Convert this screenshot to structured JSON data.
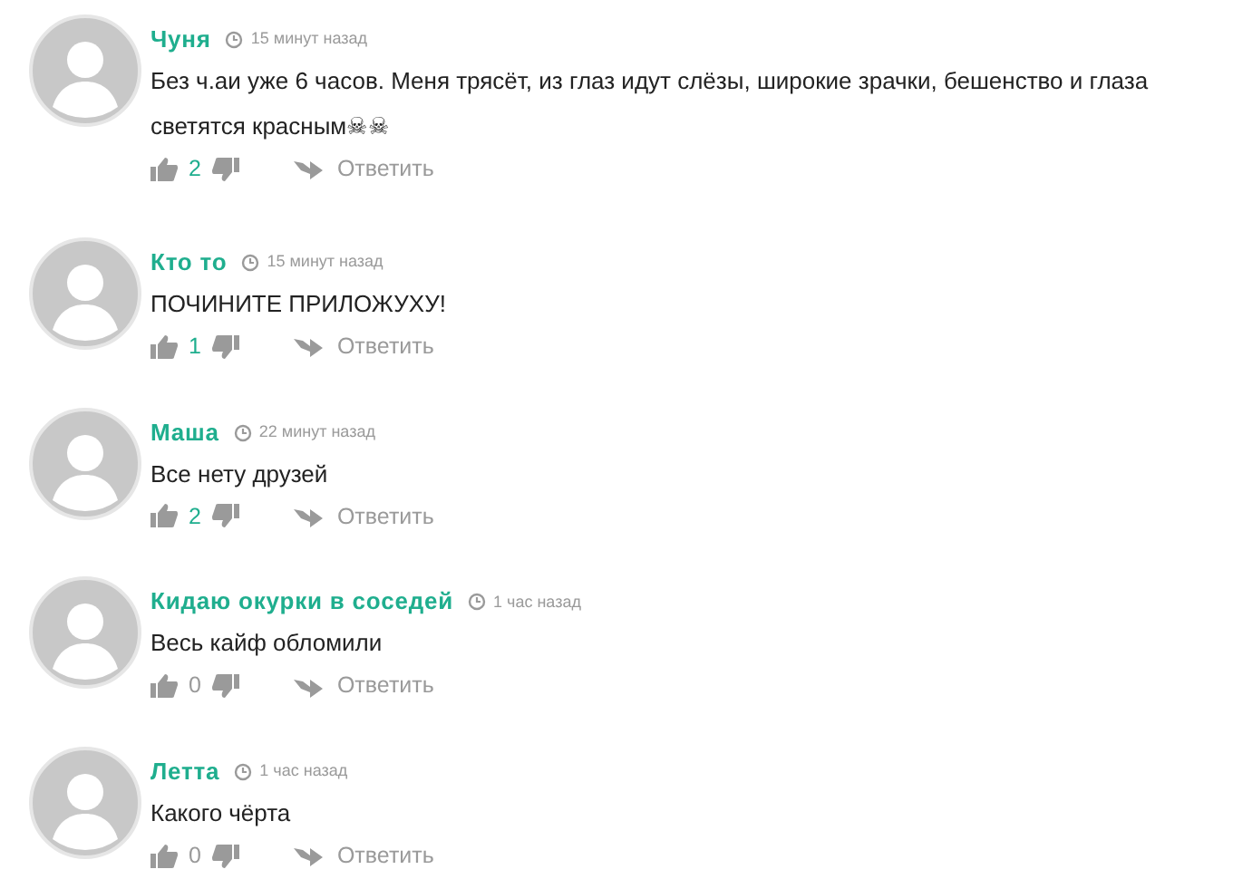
{
  "comments": [
    {
      "author": "Чуня",
      "time": "15 минут назад",
      "text": "Без ч.аи уже 6 часов. Меня трясёт, из глаз идут слёзы, широкие зрачки, бешенство и глаза светятся красным☠☠",
      "likes": "2",
      "likes_highlighted": true,
      "reply": "Ответить"
    },
    {
      "author": "Кто то",
      "time": "15 минут назад",
      "text": "ПОЧИНИТЕ ПРИЛОЖУХУ!",
      "likes": "1",
      "likes_highlighted": true,
      "reply": "Ответить"
    },
    {
      "author": "Маша",
      "time": "22 минут назад",
      "text": "Все нету друзей",
      "likes": "2",
      "likes_highlighted": true,
      "reply": "Ответить"
    },
    {
      "author": "Кидаю окурки в соседей",
      "time": "1 час назад",
      "text": "Весь кайф обломили",
      "likes": "0",
      "likes_highlighted": false,
      "reply": "Ответить"
    },
    {
      "author": "Летта",
      "time": "1 час назад",
      "text": "Какого чёрта",
      "likes": "0",
      "likes_highlighted": false,
      "reply": "Ответить"
    }
  ]
}
